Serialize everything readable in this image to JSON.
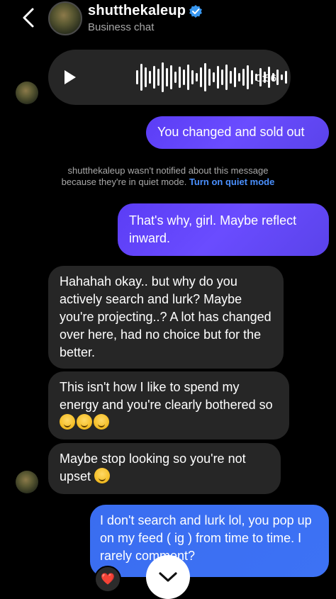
{
  "header": {
    "username": "shutthekaleup",
    "subtitle": "Business chat"
  },
  "voice_message": {
    "duration": "0:56"
  },
  "messages": [
    {
      "direction": "outgoing",
      "text": "You changed and sold out"
    },
    {
      "direction": "outgoing",
      "text": "That's why, girl. Maybe reflect inward."
    },
    {
      "direction": "incoming",
      "text": "Hahahah okay.. but why do you actively search and lurk? Maybe you're projecting..? A lot has changed over here, had no choice but for the better."
    },
    {
      "direction": "incoming",
      "text": "This isn't how I like to spend my energy and you're clearly bothered so"
    },
    {
      "direction": "incoming",
      "text": "Maybe stop looking so you're not upset"
    },
    {
      "direction": "outgoing",
      "text": "I don't search and lurk lol, you pop up on my feed ( ig ) from time to time. I rarely comment?"
    }
  ],
  "quiet_notice": {
    "line1": "shutthekaleup wasn't notified about this message",
    "line2_prefix": "because they're in quiet mode.",
    "link": "Turn on quiet mode"
  },
  "reaction": {
    "emoji": "❤️"
  },
  "icons": {
    "back": "chevron-left-icon",
    "verified": "verified-badge-icon",
    "play": "play-icon",
    "scroll": "chevron-down-icon"
  },
  "colors": {
    "background": "#000000",
    "incoming_bubble": "#262626",
    "outgoing_bubble": "#5b3df5",
    "outgoing_bubble_last": "#3a6df0",
    "link": "#4a90ff",
    "verified": "#3897f0"
  }
}
